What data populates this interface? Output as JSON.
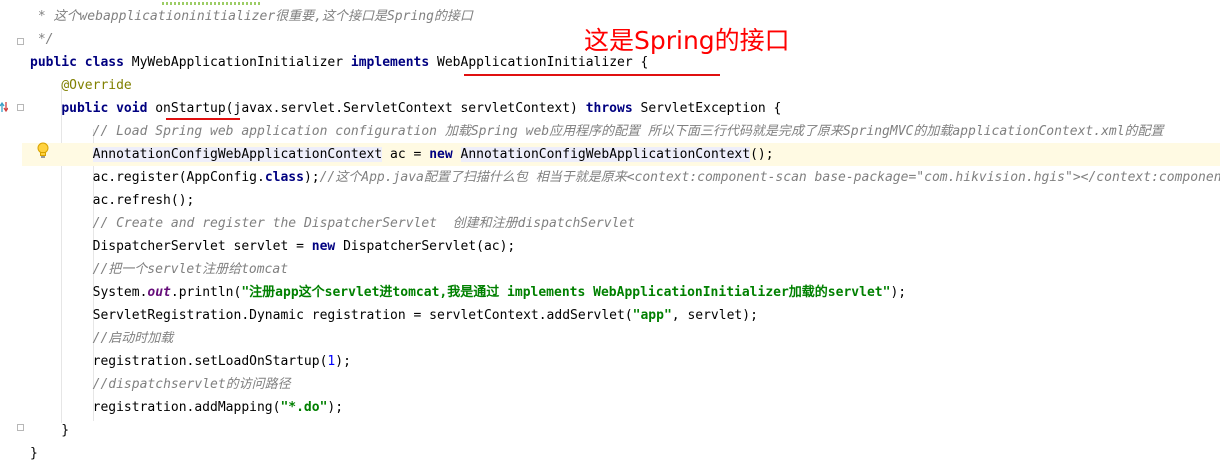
{
  "editor": {
    "lines": [
      {
        "tokens": [
          {
            "t": " * 这个webapplicationinitializer很重要,这个接口是Spring的接口",
            "c": "cm"
          }
        ]
      },
      {
        "tokens": [
          {
            "t": " */",
            "c": "cm"
          }
        ]
      },
      {
        "tokens": [
          {
            "t": "public class",
            "c": "kw"
          },
          {
            "t": " MyWebApplicationInitializer "
          },
          {
            "t": "implements",
            "c": "kw"
          },
          {
            "t": " WebApplicationInitializer {"
          }
        ]
      },
      {
        "tokens": [
          {
            "t": "    "
          },
          {
            "t": "@Override",
            "c": "an"
          }
        ]
      },
      {
        "tokens": [
          {
            "t": "    "
          },
          {
            "t": "public void",
            "c": "kw"
          },
          {
            "t": " onStartup(javax.servlet.ServletContext servletContext) "
          },
          {
            "t": "throws",
            "c": "kw"
          },
          {
            "t": " ServletException {"
          }
        ]
      },
      {
        "tokens": [
          {
            "t": "        "
          },
          {
            "t": "// Load Spring web application configuration 加载Spring web应用程序的配置 所以下面三行代码就是完成了原来SpringMVC的加载applicationContext.xml的配置",
            "c": "cm"
          }
        ]
      },
      {
        "tokens": [
          {
            "t": "        "
          },
          {
            "t": "AnnotationConfigWebApplicationContext",
            "c": "mk"
          },
          {
            "t": " ac = "
          },
          {
            "t": "new",
            "c": "kw"
          },
          {
            "t": " "
          },
          {
            "t": "AnnotationConfigWebApplicationContext",
            "c": "mk"
          },
          {
            "t": "();"
          }
        ]
      },
      {
        "tokens": [
          {
            "t": "        ac.register(AppConfig."
          },
          {
            "t": "class",
            "c": "kw"
          },
          {
            "t": ");"
          },
          {
            "t": "//这个App.java配置了扫描什么包 相当于就是原来<context:component-scan base-package=\"com.hikvision.hgis\"></context:component-scan>",
            "c": "cm"
          }
        ]
      },
      {
        "tokens": [
          {
            "t": "        ac.refresh();"
          }
        ]
      },
      {
        "tokens": [
          {
            "t": "        "
          },
          {
            "t": "// Create and register the DispatcherServlet  创建和注册dispatchServlet",
            "c": "cm"
          }
        ]
      },
      {
        "tokens": [
          {
            "t": "        DispatcherServlet servlet = "
          },
          {
            "t": "new",
            "c": "kw"
          },
          {
            "t": " DispatcherServlet(ac);"
          }
        ]
      },
      {
        "tokens": [
          {
            "t": "        "
          },
          {
            "t": "//把一个servlet注册给tomcat",
            "c": "cm"
          }
        ]
      },
      {
        "tokens": [
          {
            "t": "        System."
          },
          {
            "t": "out",
            "c": "fd"
          },
          {
            "t": ".println("
          },
          {
            "t": "\"注册app这个servlet进tomcat,我是通过 implements WebApplicationInitializer加载的servlet\"",
            "c": "st"
          },
          {
            "t": ");"
          }
        ]
      },
      {
        "tokens": [
          {
            "t": "        ServletRegistration.Dynamic registration = servletContext.addServlet("
          },
          {
            "t": "\"app\"",
            "c": "st"
          },
          {
            "t": ", servlet);"
          }
        ]
      },
      {
        "tokens": [
          {
            "t": "        "
          },
          {
            "t": "//启动时加载",
            "c": "cm"
          }
        ]
      },
      {
        "tokens": [
          {
            "t": "        registration.setLoadOnStartup("
          },
          {
            "t": "1",
            "c": "nu"
          },
          {
            "t": ");"
          }
        ]
      },
      {
        "tokens": [
          {
            "t": "        "
          },
          {
            "t": "//dispatchservlet的访问路径",
            "c": "cm"
          }
        ]
      },
      {
        "tokens": [
          {
            "t": "        registration.addMapping("
          },
          {
            "t": "\"*.do\"",
            "c": "st"
          },
          {
            "t": ");"
          }
        ]
      },
      {
        "tokens": [
          {
            "t": "    }"
          }
        ]
      },
      {
        "tokens": [
          {
            "t": "}"
          }
        ]
      }
    ],
    "highlighted_line": 6
  },
  "annotation": {
    "text": "这是Spring的接口"
  },
  "colors": {
    "annotation_red": "#ff0000",
    "keyword": "#000080",
    "comment": "#808080",
    "string": "#008000",
    "annotation_code": "#808000"
  },
  "icons": {
    "gutter": [
      "override-method-icon",
      "lightbulb-intention-icon",
      "fold-marker-icon"
    ]
  }
}
